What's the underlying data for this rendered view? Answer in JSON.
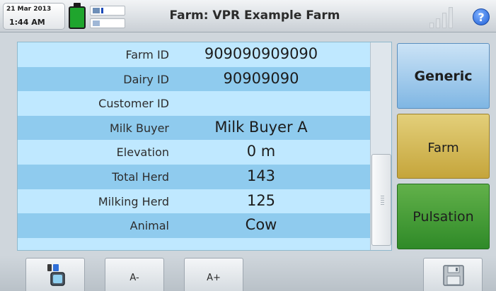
{
  "header": {
    "date": "21 Mar 2013",
    "time": "1:44 AM",
    "title": "Farm: VPR Example Farm",
    "help_label": "?"
  },
  "fields": [
    {
      "label": "Farm ID",
      "value": "909090909090"
    },
    {
      "label": "Dairy ID",
      "value": "90909090"
    },
    {
      "label": "Customer ID",
      "value": ""
    },
    {
      "label": "Milk Buyer",
      "value": "Milk Buyer A"
    },
    {
      "label": "Elevation",
      "value": "0 m"
    },
    {
      "label": "Total Herd",
      "value": "143"
    },
    {
      "label": "Milking Herd",
      "value": "125"
    },
    {
      "label": "Animal",
      "value": "Cow"
    }
  ],
  "side_buttons": {
    "generic": "Generic",
    "farm": "Farm",
    "pulsation": "Pulsation"
  },
  "toolbar": {
    "font_decrease": "A-",
    "font_increase": "A+"
  },
  "colors": {
    "row_light": "#bfe8ff",
    "row_dark": "#8fcbee",
    "generic_btn": "#7fb6e3",
    "farm_btn": "#c5a53b",
    "pulsation_btn": "#2f8a28",
    "battery": "#1fa52d",
    "help_icon": "#1f5fd6"
  },
  "icons": [
    "battery-icon",
    "network-icon",
    "usb-icon",
    "signal-strength-icon",
    "help-icon",
    "usb-drive-icon",
    "save-icon"
  ]
}
